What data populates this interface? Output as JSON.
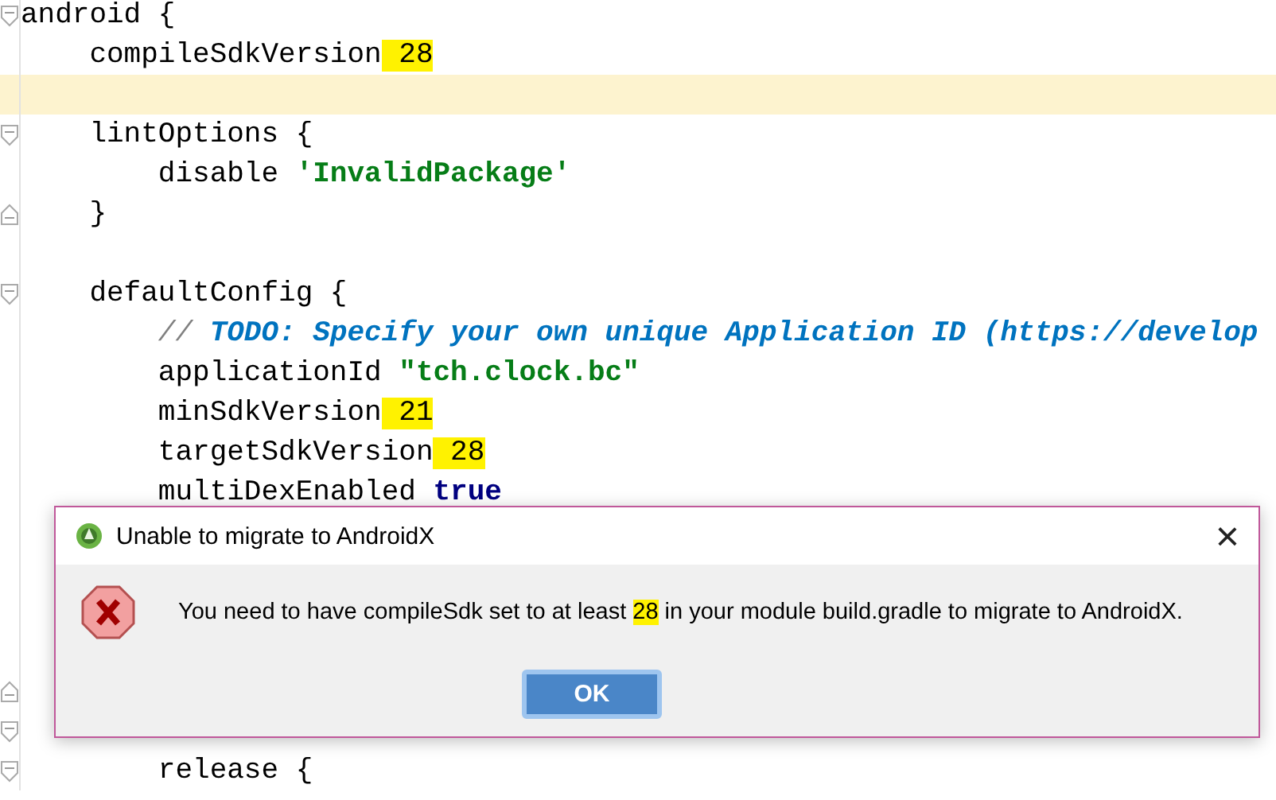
{
  "editor": {
    "lines": [
      {
        "fold_start": true,
        "fold_end": false,
        "current": false,
        "tokens": [
          {
            "kind": "plain",
            "text": "android {"
          }
        ]
      },
      {
        "fold_start": false,
        "fold_end": false,
        "current": false,
        "tokens": [
          {
            "kind": "plain",
            "text": "    compileSdkVersion"
          },
          {
            "kind": "number",
            "text": " 28",
            "highlight": true
          }
        ]
      },
      {
        "fold_start": false,
        "fold_end": false,
        "current": true
      },
      {
        "fold_start": true,
        "fold_end": false,
        "current": false,
        "tokens": [
          {
            "kind": "plain",
            "text": "    lintOptions {"
          }
        ]
      },
      {
        "fold_start": false,
        "fold_end": false,
        "current": false,
        "tokens": [
          {
            "kind": "plain",
            "text": "        disable "
          },
          {
            "kind": "string",
            "text": "'InvalidPackage'"
          }
        ]
      },
      {
        "fold_start": false,
        "fold_end": true,
        "current": false,
        "tokens": [
          {
            "kind": "plain",
            "text": "    }"
          }
        ]
      },
      {
        "fold_start": false,
        "fold_end": false,
        "current": false
      },
      {
        "fold_start": true,
        "fold_end": false,
        "current": false,
        "tokens": [
          {
            "kind": "plain",
            "text": "    defaultConfig {"
          }
        ]
      },
      {
        "fold_start": false,
        "fold_end": false,
        "current": false,
        "tokens": [
          {
            "kind": "comment",
            "text": "        // "
          },
          {
            "kind": "todo",
            "text": "TODO: Specify your own unique Application ID (https://develop"
          }
        ]
      },
      {
        "fold_start": false,
        "fold_end": false,
        "current": false,
        "tokens": [
          {
            "kind": "plain",
            "text": "        applicationId "
          },
          {
            "kind": "string",
            "text": "\"tch.clock.bc\""
          }
        ]
      },
      {
        "fold_start": false,
        "fold_end": false,
        "current": false,
        "tokens": [
          {
            "kind": "plain",
            "text": "        minSdkVersion"
          },
          {
            "kind": "number",
            "text": " 21",
            "highlight": true
          }
        ]
      },
      {
        "fold_start": false,
        "fold_end": false,
        "current": false,
        "tokens": [
          {
            "kind": "plain",
            "text": "        targetSdkVersion"
          },
          {
            "kind": "number",
            "text": " 28",
            "highlight": true
          }
        ]
      },
      {
        "fold_start": false,
        "fold_end": false,
        "current": false,
        "tokens": [
          {
            "kind": "plain",
            "text": "        multiDexEnabled "
          },
          {
            "kind": "keyword",
            "text": "true"
          }
        ]
      },
      {
        "fold_start": false,
        "fold_end": false,
        "current": false
      },
      {
        "fold_start": false,
        "fold_end": false,
        "current": false
      },
      {
        "fold_start": false,
        "fold_end": false,
        "current": false
      },
      {
        "fold_start": false,
        "fold_end": false,
        "current": false
      },
      {
        "fold_start": false,
        "fold_end": true,
        "current": false
      },
      {
        "fold_start": true,
        "fold_end": false,
        "current": false
      },
      {
        "fold_start": true,
        "fold_end": false,
        "current": false,
        "tokens": [
          {
            "kind": "plain",
            "text": "        release {"
          }
        ]
      }
    ]
  },
  "dialog": {
    "title": "Unable to migrate to AndroidX",
    "close": "×",
    "message": [
      {
        "text": "You need to have compileSdk set to at least "
      },
      {
        "text": "28",
        "highlight": true
      },
      {
        "text": " in your module build.gradle to migrate to AndroidX."
      }
    ],
    "button": "OK"
  }
}
